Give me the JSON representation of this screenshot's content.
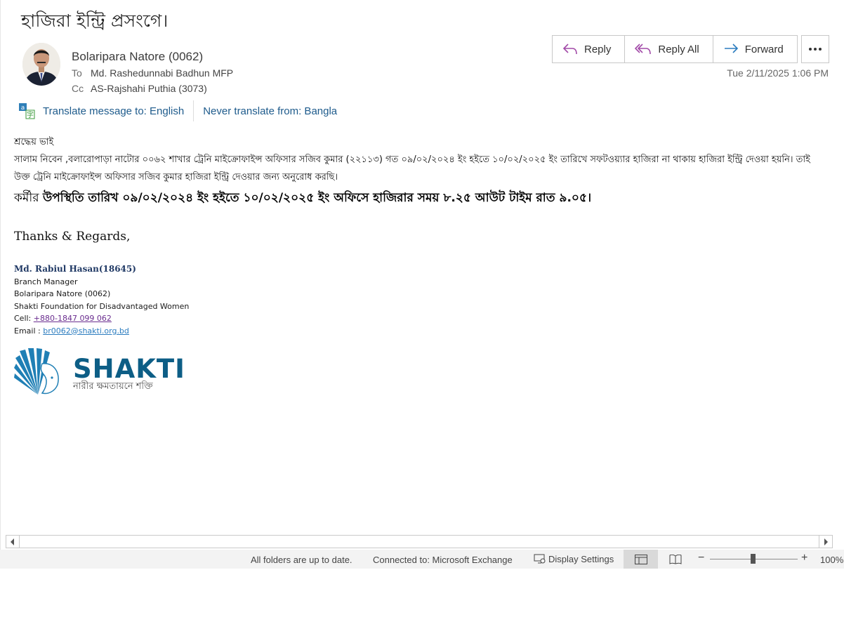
{
  "subject": "হাজিরা ইন্ট্রি প্রসংগে।",
  "header": {
    "sender": "Bolaripara Natore (0062)",
    "to_label": "To",
    "to": "Md. Rashedunnabi Badhun MFP",
    "cc_label": "Cc",
    "cc": "AS-Rajshahi Puthia (3073)",
    "date": "Tue 2/11/2025 1:06 PM"
  },
  "actions": {
    "reply": "Reply",
    "reply_all": "Reply All",
    "forward": "Forward",
    "more_icon": "ellipsis-icon"
  },
  "translate": {
    "translate_to": "Translate message to: English",
    "never_translate": "Never translate from: Bangla"
  },
  "body": {
    "greeting": "শ্রদ্ধেয় ভাই",
    "paragraph": "সালাম নিবেন ,বলারোপাড়া নাটোর ০০৬২ শাখার ট্রেনি মাইক্রোফাইন্স অফিসার সজিব কুমার (২২১১৩) গত ০৯/০২/২০২৪ ইং হইতে ১০/০২/২০২৫ ইং তারিখে সফটওয়্যার হাজিরা না থাকায় হাজিরা ইন্ট্রি দেওয়া হয়নি। তাই উক্ত ট্রেনি মাইক্রোফাইন্স অফিসার সজিব কুমার হাজিরা ইন্ট্রি দেওয়ার জন্য অনুরোধ করছি।",
    "bold_prefix": "কর্মীর ",
    "bold_text": "উপস্থিতি তারিখ ০৯/০২/২০২৪ ইং হইতে ১০/০২/২০২৫ ইং অফিসে হাজিরার সময় ৮.২৫ আউট টাইম রাত ৯.০৫।",
    "thanks": "Thanks & Regards,"
  },
  "signature": {
    "name": "Md. Rabiul Hasan(18645)",
    "title": "Branch Manager",
    "branch": "Bolaripara Natore (0062)",
    "org": "Shakti Foundation for Disadvantaged Women",
    "cell_label": "Cell: ",
    "cell": "+880-1847 099 062",
    "email_label": "Email : ",
    "email": "br0062@shakti.org.bd"
  },
  "logo": {
    "word": "SHAKTI",
    "tagline": "নারীর ক্ষমতায়নে শক্তি"
  },
  "status_bar": {
    "sync": "All folders are up to date.",
    "connection": "Connected to: Microsoft Exchange",
    "display_settings": "Display Settings",
    "zoom": "100%"
  },
  "colors": {
    "link": "#1e5b8c",
    "reply_icon": "#a24aa8",
    "forward_icon": "#2b7cbf",
    "logo_blue": "#0d5e86"
  }
}
